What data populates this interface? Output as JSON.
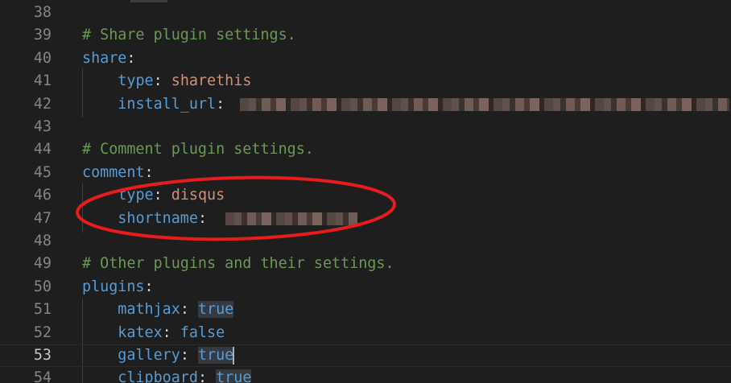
{
  "editor": {
    "lines": [
      {
        "no": "38",
        "tokens": []
      },
      {
        "no": "39",
        "tokens": [
          {
            "t": "# Share plugin settings.",
            "c": "c-comment"
          }
        ]
      },
      {
        "no": "40",
        "tokens": [
          {
            "t": "share",
            "c": "c-key"
          },
          {
            "t": ":",
            "c": "c-punct"
          }
        ]
      },
      {
        "no": "41",
        "tokens": [
          {
            "t": "    "
          },
          {
            "t": "type",
            "c": "c-key"
          },
          {
            "t": ": ",
            "c": "c-punct"
          },
          {
            "t": "sharethis",
            "c": "c-str"
          }
        ]
      },
      {
        "no": "42",
        "tokens": [
          {
            "t": "    "
          },
          {
            "t": "install_url",
            "c": "c-key"
          },
          {
            "t": ": ",
            "c": "c-punct"
          }
        ]
      },
      {
        "no": "43",
        "tokens": []
      },
      {
        "no": "44",
        "tokens": [
          {
            "t": "# Comment plugin settings.",
            "c": "c-comment"
          }
        ]
      },
      {
        "no": "45",
        "tokens": [
          {
            "t": "comment",
            "c": "c-key"
          },
          {
            "t": ":",
            "c": "c-punct"
          }
        ]
      },
      {
        "no": "46",
        "tokens": [
          {
            "t": "    "
          },
          {
            "t": "type",
            "c": "c-key"
          },
          {
            "t": ": ",
            "c": "c-punct"
          },
          {
            "t": "disqus",
            "c": "c-str"
          }
        ]
      },
      {
        "no": "47",
        "tokens": [
          {
            "t": "    "
          },
          {
            "t": "shortname",
            "c": "c-key"
          },
          {
            "t": ": ",
            "c": "c-punct"
          }
        ]
      },
      {
        "no": "48",
        "tokens": []
      },
      {
        "no": "49",
        "tokens": [
          {
            "t": "# Other plugins and their settings.",
            "c": "c-comment"
          }
        ]
      },
      {
        "no": "50",
        "tokens": [
          {
            "t": "plugins",
            "c": "c-key"
          },
          {
            "t": ":",
            "c": "c-punct"
          }
        ]
      },
      {
        "no": "51",
        "tokens": [
          {
            "t": "    "
          },
          {
            "t": "mathjax",
            "c": "c-key"
          },
          {
            "t": ": ",
            "c": "c-punct"
          },
          {
            "t": "true",
            "c": "c-bool",
            "hl": true
          }
        ]
      },
      {
        "no": "52",
        "tokens": [
          {
            "t": "    "
          },
          {
            "t": "katex",
            "c": "c-key"
          },
          {
            "t": ": ",
            "c": "c-punct"
          },
          {
            "t": "false",
            "c": "c-bool"
          }
        ]
      },
      {
        "no": "53",
        "current": true,
        "tokens": [
          {
            "t": "    "
          },
          {
            "t": "gallery",
            "c": "c-key"
          },
          {
            "t": ": ",
            "c": "c-punct"
          },
          {
            "t": "true",
            "c": "c-bool",
            "hl": true,
            "cursor": true
          }
        ]
      },
      {
        "no": "54",
        "tokens": [
          {
            "t": "    "
          },
          {
            "t": "clipboard",
            "c": "c-key"
          },
          {
            "t": ": ",
            "c": "c-punct"
          },
          {
            "t": "true",
            "c": "c-bool",
            "hl": true
          }
        ]
      }
    ]
  },
  "colors": {
    "background": "#1e1e1e",
    "line_number": "#858585",
    "comment": "#6a9955",
    "key": "#569cd6",
    "string": "#ce9178",
    "annotation": "#e81c1c"
  },
  "annotation": {
    "shape": "ellipse",
    "target": "comment plugin type and shortname"
  }
}
